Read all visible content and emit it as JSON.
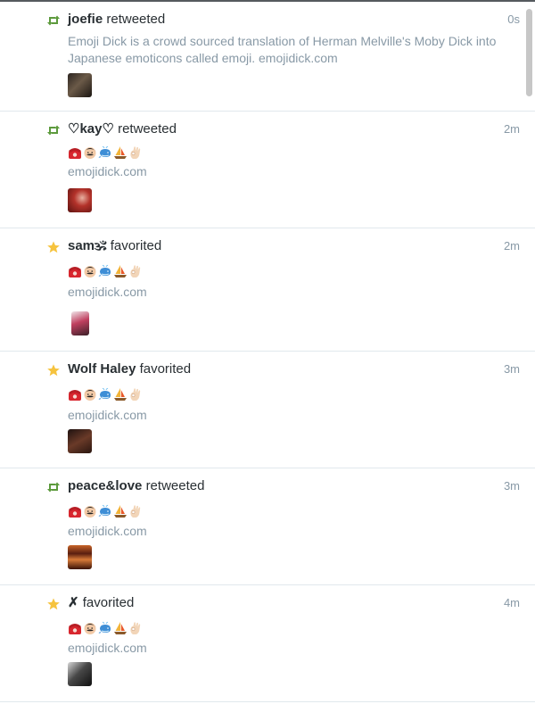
{
  "feed": {
    "items": [
      {
        "actor": "joefie",
        "verb": "retweeted",
        "action": "retweet",
        "time": "0s",
        "text": "Emoji Dick is a crowd sourced translation of Herman Melville's Moby Dick into Japanese emoticons called emoji. emojidick.com"
      },
      {
        "actor": "♡kay♡",
        "verb": "retweeted",
        "action": "retweet",
        "time": "2m",
        "emoji": [
          "telephone",
          "man-mustache",
          "whale",
          "sailboat",
          "ok-hand"
        ],
        "link": "emojidick.com"
      },
      {
        "actor": "sam🕉",
        "verb": "favorited",
        "action": "favorite",
        "time": "2m",
        "emoji": [
          "telephone",
          "man-mustache",
          "whale",
          "sailboat",
          "ok-hand"
        ],
        "link": "emojidick.com"
      },
      {
        "actor": "Wolf Haley",
        "verb": "favorited",
        "action": "favorite",
        "time": "3m",
        "emoji": [
          "telephone",
          "man-mustache",
          "whale",
          "sailboat",
          "ok-hand"
        ],
        "link": "emojidick.com"
      },
      {
        "actor": "peace&love",
        "verb": "retweeted",
        "action": "retweet",
        "time": "3m",
        "emoji": [
          "telephone",
          "man-mustache",
          "whale",
          "sailboat",
          "ok-hand"
        ],
        "link": "emojidick.com"
      },
      {
        "actor": "✗",
        "verb": "favorited",
        "action": "favorite",
        "time": "4m",
        "emoji": [
          "telephone",
          "man-mustache",
          "whale",
          "sailboat",
          "ok-hand"
        ],
        "link": "emojidick.com"
      }
    ]
  },
  "colors": {
    "retweet": "#5c9a3c",
    "favorite": "#f6c33e",
    "muted_text": "#8899a6",
    "divider": "#e1e8ed"
  },
  "icons": {
    "retweet": "retweet-icon",
    "favorite": "star-icon"
  }
}
